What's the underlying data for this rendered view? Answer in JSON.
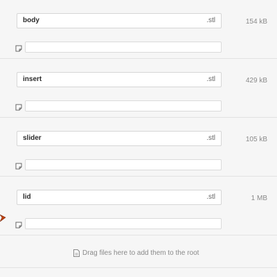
{
  "files": [
    {
      "name": "body",
      "extension": ".stl",
      "size": "154 kB",
      "note": ""
    },
    {
      "name": "insert",
      "extension": ".stl",
      "size": "429 kB",
      "note": ""
    },
    {
      "name": "slider",
      "extension": ".stl",
      "size": "105 kB",
      "note": ""
    },
    {
      "name": "lid",
      "extension": ".stl",
      "size": "1 MB",
      "note": ""
    }
  ],
  "drop_zone": {
    "text": "Drag files here to add them to the root",
    "icon": "file-icon"
  },
  "icons": {
    "note": "note-icon",
    "cursor": "drag-cursor-icon"
  },
  "colors": {
    "background": "#f6f6f6",
    "field_border": "#d6d6d6",
    "cursor": "#c2410c"
  }
}
